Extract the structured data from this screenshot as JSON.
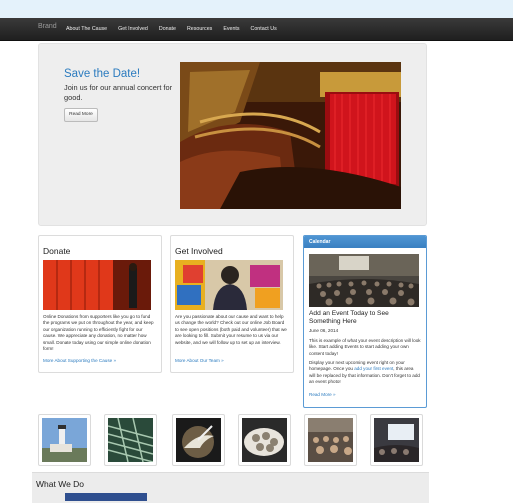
{
  "nav": {
    "brand": "Brand",
    "links": [
      "About The Cause",
      "Get Involved",
      "Donate",
      "Resources",
      "Events",
      "Contact Us"
    ]
  },
  "hero": {
    "title": "Save the Date!",
    "text": "Join us for our annual concert for good.",
    "button": "Read More"
  },
  "donate": {
    "title": "Donate",
    "text": "Online Donations from supporters like you go to fund the programs we put on throughout the year, and keep our organization running to efficiently fight for our cause. We appreciate any donation, no matter how small. Donate today using our simple online donation form!",
    "link": "More About Supporting the Cause »"
  },
  "involved": {
    "title": "Get Involved",
    "text": "Are you passionate about our cause and want to help us change the world? Check out our online Job Board to see open positions (both paid and volunteer) that we are looking to fill. Submit your resume to us via our website, and we will follow up to set up an interview.",
    "link": "More About Our Team »"
  },
  "calendar": {
    "header": "Calendar",
    "title": "Add an Event Today to See Something Here",
    "date": "June 06, 2014",
    "text1": "This is example of what your event description will look like. Start adding Events to start adding your own content today!",
    "text2a": "Display your next upcoming event right on your homepage. Once you ",
    "text2link": "add your first event",
    "text2b": ", this area will be replaced by that information. Don't forget to add an event photo!",
    "link": "Read More »"
  },
  "gallery": {
    "items": [
      "lighthouse-photo",
      "circuit-board-photo",
      "bird-photo",
      "dish-photo",
      "audience-photo",
      "presentation-photo"
    ]
  },
  "what_we_do": {
    "title": "What We Do"
  }
}
